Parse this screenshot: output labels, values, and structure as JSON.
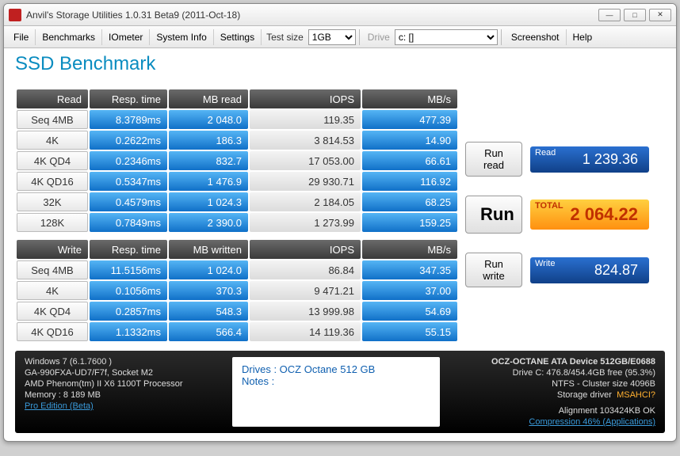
{
  "title": "Anvil's Storage Utilities 1.0.31 Beta9 (2011-Oct-18)",
  "menu": {
    "file": "File",
    "benchmarks": "Benchmarks",
    "iometer": "IOmeter",
    "systeminfo": "System Info",
    "settings": "Settings",
    "testsize_label": "Test size",
    "testsize_value": "1GB",
    "drive_label": "Drive",
    "drive_value": "c: []",
    "screenshot": "Screenshot",
    "help": "Help"
  },
  "header_title": "SSD Benchmark",
  "read": {
    "hdr": {
      "label": "Read",
      "rt": "Resp. time",
      "mb": "MB read",
      "iops": "IOPS",
      "mbs": "MB/s"
    },
    "rows": [
      {
        "label": "Seq 4MB",
        "rt": "8.3789ms",
        "mb": "2 048.0",
        "iops": "119.35",
        "mbs": "477.39"
      },
      {
        "label": "4K",
        "rt": "0.2622ms",
        "mb": "186.3",
        "iops": "3 814.53",
        "mbs": "14.90"
      },
      {
        "label": "4K QD4",
        "rt": "0.2346ms",
        "mb": "832.7",
        "iops": "17 053.00",
        "mbs": "66.61"
      },
      {
        "label": "4K QD16",
        "rt": "0.5347ms",
        "mb": "1 476.9",
        "iops": "29 930.71",
        "mbs": "116.92"
      },
      {
        "label": "32K",
        "rt": "0.4579ms",
        "mb": "1 024.3",
        "iops": "2 184.05",
        "mbs": "68.25"
      },
      {
        "label": "128K",
        "rt": "0.7849ms",
        "mb": "2 390.0",
        "iops": "1 273.99",
        "mbs": "159.25"
      }
    ]
  },
  "write": {
    "hdr": {
      "label": "Write",
      "rt": "Resp. time",
      "mb": "MB written",
      "iops": "IOPS",
      "mbs": "MB/s"
    },
    "rows": [
      {
        "label": "Seq 4MB",
        "rt": "11.5156ms",
        "mb": "1 024.0",
        "iops": "86.84",
        "mbs": "347.35"
      },
      {
        "label": "4K",
        "rt": "0.1056ms",
        "mb": "370.3",
        "iops": "9 471.21",
        "mbs": "37.00"
      },
      {
        "label": "4K QD4",
        "rt": "0.2857ms",
        "mb": "548.3",
        "iops": "13 999.98",
        "mbs": "54.69"
      },
      {
        "label": "4K QD16",
        "rt": "1.1332ms",
        "mb": "566.4",
        "iops": "14 119.36",
        "mbs": "55.15"
      }
    ]
  },
  "buttons": {
    "runread": "Run read",
    "run": "Run",
    "runwrite": "Run write"
  },
  "scores": {
    "read_label": "Read",
    "read": "1 239.36",
    "total_label": "TOTAL",
    "total": "2 064.22",
    "write_label": "Write",
    "write": "824.87"
  },
  "footer": {
    "os": "Windows 7 (6.1.7600 )",
    "mobo": "GA-990FXA-UD7/F7f, Socket M2",
    "cpu": "AMD Phenom(tm) II X6 1100T Processor",
    "mem": "Memory : 8 189 MB",
    "edition": "Pro Edition (Beta)",
    "drives": "Drives : OCZ Octane 512 GB",
    "notes": "Notes :",
    "device": "OCZ-OCTANE ATA Device 512GB/E0688",
    "drivec": "Drive C: 476.8/454.4GB free (95.3%)",
    "fs": "NTFS - Cluster size 4096B",
    "driver_label": "Storage driver",
    "driver": "MSAHCI?",
    "align": "Alignment 103424KB OK",
    "compression": "Compression 46% (Applications)"
  }
}
